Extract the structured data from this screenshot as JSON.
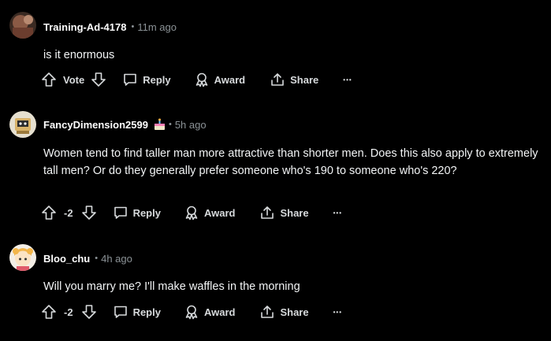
{
  "comments": [
    {
      "username": "Training-Ad-4178",
      "separator": "•",
      "time": "11m ago",
      "has_flair": false,
      "body": "is it enormous",
      "vote_label": "Vote",
      "reply_label": "Reply",
      "award_label": "Award",
      "share_label": "Share",
      "more_label": "•••"
    },
    {
      "username": "FancyDimension2599",
      "separator": "•",
      "time": "5h ago",
      "has_flair": true,
      "body": "Women tend to find taller man more attractive than shorter men. Does this also apply to extremely tall men? Or do they generally prefer someone who's 190 to someone who's 220?",
      "vote_label": "-2",
      "reply_label": "Reply",
      "award_label": "Award",
      "share_label": "Share",
      "more_label": "•••"
    },
    {
      "username": "Bloo_chu",
      "separator": "•",
      "time": "4h ago",
      "has_flair": false,
      "body": "Will you marry me? I'll make waffles in the morning",
      "vote_label": "-2",
      "reply_label": "Reply",
      "award_label": "Award",
      "share_label": "Share",
      "more_label": "•••"
    }
  ],
  "colors": {
    "background": "#000000",
    "text": "#f2f4f5",
    "muted": "#8b9296"
  },
  "icons": [
    "upvote-icon",
    "downvote-icon",
    "comment-icon",
    "award-icon",
    "share-icon",
    "more-icon"
  ]
}
